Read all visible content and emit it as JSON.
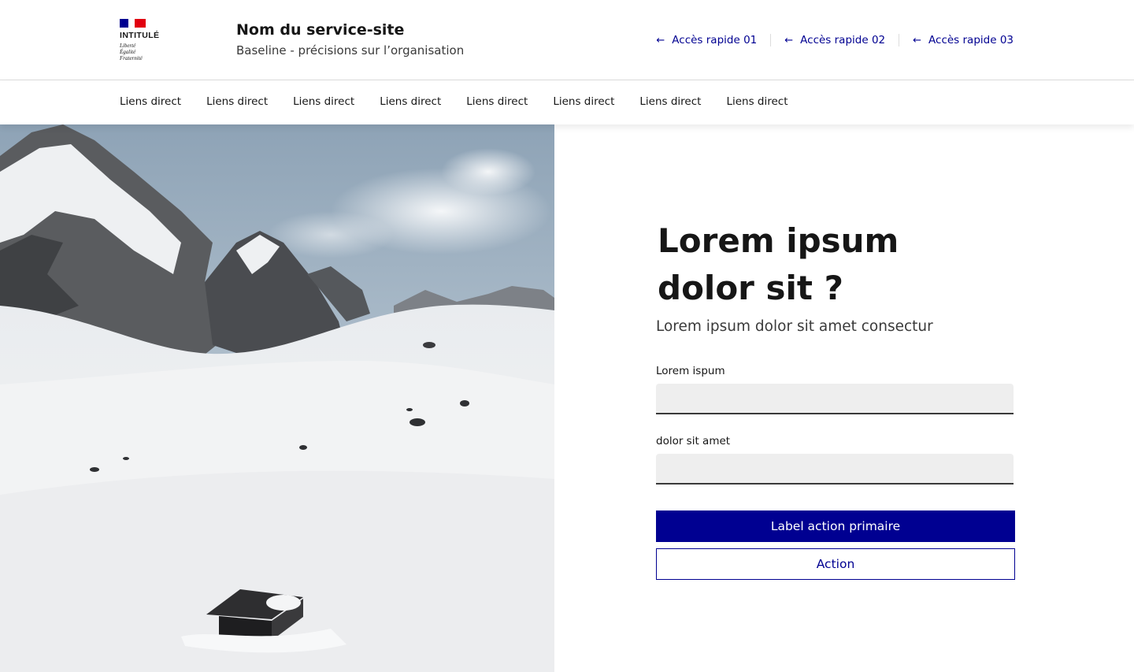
{
  "header": {
    "logo": {
      "intitule": "INTITULÉ",
      "devise": [
        "Liberté",
        "Égalité",
        "Fraternité"
      ]
    },
    "service_name": "Nom du service-site",
    "baseline": "Baseline - précisions sur l’organisation",
    "quick_access": [
      {
        "label": "Accès rapide 01",
        "icon": "arrow-left-icon"
      },
      {
        "label": "Accès rapide 02",
        "icon": "arrow-left-icon"
      },
      {
        "label": "Accès rapide 03",
        "icon": "arrow-left-icon"
      }
    ]
  },
  "nav": {
    "items": [
      {
        "label": "Liens direct"
      },
      {
        "label": "Liens direct"
      },
      {
        "label": "Liens direct"
      },
      {
        "label": "Liens direct"
      },
      {
        "label": "Liens direct"
      },
      {
        "label": "Liens direct"
      },
      {
        "label": "Liens direct"
      },
      {
        "label": "Liens direct"
      }
    ]
  },
  "main": {
    "title": "Lorem ipsum dolor sit ?",
    "subtitle": "Lorem ipsum dolor sit amet consectur",
    "fields": [
      {
        "label": "Lorem ispum",
        "value": "",
        "placeholder": ""
      },
      {
        "label": "dolor sit amet",
        "value": "",
        "placeholder": ""
      }
    ],
    "primary_button": "Label action primaire",
    "secondary_button": "Action"
  },
  "colors": {
    "accent": "#000091",
    "flag_red": "#e1000f",
    "text": "#161616",
    "input_bg": "#eeeeee"
  }
}
